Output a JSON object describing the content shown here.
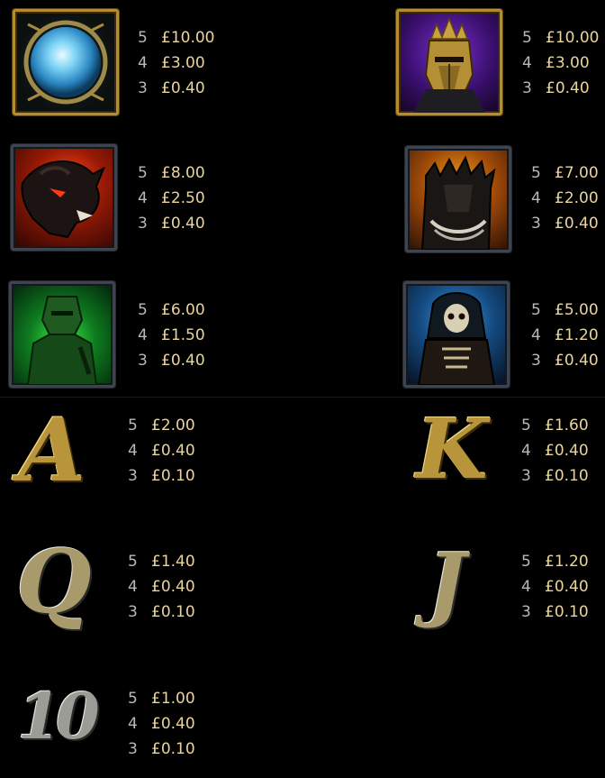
{
  "symbols": [
    {
      "name": "orb",
      "pays": [
        {
          "count": "5",
          "value": "£10.00"
        },
        {
          "count": "4",
          "value": "£3.00"
        },
        {
          "count": "3",
          "value": "£0.40"
        }
      ]
    },
    {
      "name": "crowned-knight",
      "pays": [
        {
          "count": "5",
          "value": "£10.00"
        },
        {
          "count": "4",
          "value": "£3.00"
        },
        {
          "count": "3",
          "value": "£0.40"
        }
      ]
    },
    {
      "name": "demon-dragon",
      "pays": [
        {
          "count": "5",
          "value": "£8.00"
        },
        {
          "count": "4",
          "value": "£2.50"
        },
        {
          "count": "3",
          "value": "£0.40"
        }
      ]
    },
    {
      "name": "spiked-warrior",
      "pays": [
        {
          "count": "5",
          "value": "£7.00"
        },
        {
          "count": "4",
          "value": "£2.00"
        },
        {
          "count": "3",
          "value": "£0.40"
        }
      ]
    },
    {
      "name": "green-knight",
      "pays": [
        {
          "count": "5",
          "value": "£6.00"
        },
        {
          "count": "4",
          "value": "£1.50"
        },
        {
          "count": "3",
          "value": "£0.40"
        }
      ]
    },
    {
      "name": "skeleton-reaper",
      "pays": [
        {
          "count": "5",
          "value": "£5.00"
        },
        {
          "count": "4",
          "value": "£1.20"
        },
        {
          "count": "3",
          "value": "£0.40"
        }
      ]
    },
    {
      "name": "letter-a",
      "glyph": "A",
      "pays": [
        {
          "count": "5",
          "value": "£2.00"
        },
        {
          "count": "4",
          "value": "£0.40"
        },
        {
          "count": "3",
          "value": "£0.10"
        }
      ]
    },
    {
      "name": "letter-k",
      "glyph": "K",
      "pays": [
        {
          "count": "5",
          "value": "£1.60"
        },
        {
          "count": "4",
          "value": "£0.40"
        },
        {
          "count": "3",
          "value": "£0.10"
        }
      ]
    },
    {
      "name": "letter-q",
      "glyph": "Q",
      "pays": [
        {
          "count": "5",
          "value": "£1.40"
        },
        {
          "count": "4",
          "value": "£0.40"
        },
        {
          "count": "3",
          "value": "£0.10"
        }
      ]
    },
    {
      "name": "letter-j",
      "glyph": "J",
      "pays": [
        {
          "count": "5",
          "value": "£1.20"
        },
        {
          "count": "4",
          "value": "£0.40"
        },
        {
          "count": "3",
          "value": "£0.10"
        }
      ]
    },
    {
      "name": "number-10",
      "glyph": "10",
      "pays": [
        {
          "count": "5",
          "value": "£1.00"
        },
        {
          "count": "4",
          "value": "£0.40"
        },
        {
          "count": "3",
          "value": "£0.10"
        }
      ]
    }
  ],
  "colors": {
    "background": "#000000",
    "count": "#b9b9b9",
    "value": "#e9d49a",
    "gold_frame": "#b58d2e",
    "steel_frame": "#3d4450"
  }
}
